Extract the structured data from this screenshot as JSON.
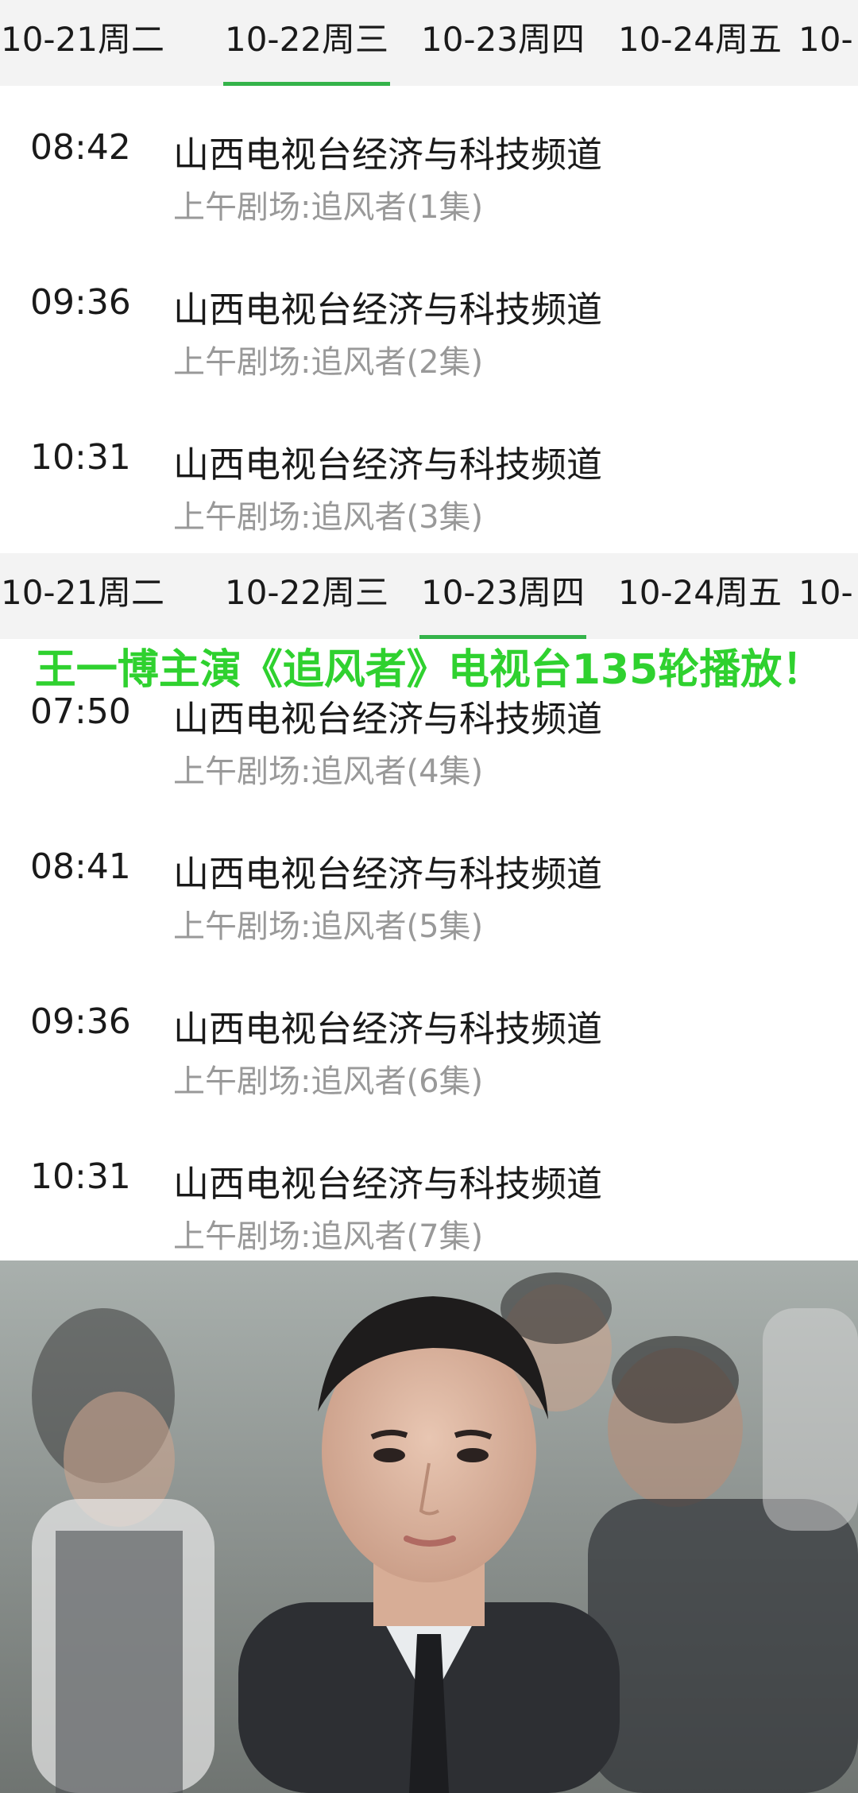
{
  "top_tabs": [
    {
      "label": "10-21周二",
      "active": false
    },
    {
      "label": "10-22周三",
      "active": true
    },
    {
      "label": "10-23周四",
      "active": false
    },
    {
      "label": "10-24周五",
      "active": false
    },
    {
      "label": "10-",
      "active": false
    }
  ],
  "top_schedule": [
    {
      "time": "08:42",
      "channel": "山西电视台经济与科技频道",
      "program": "上午剧场:追风者(1集)"
    },
    {
      "time": "09:36",
      "channel": "山西电视台经济与科技频道",
      "program": "上午剧场:追风者(2集)"
    },
    {
      "time": "10:31",
      "channel": "山西电视台经济与科技频道",
      "program": "上午剧场:追风者(3集)"
    }
  ],
  "mid_tabs": [
    {
      "label": "10-21周二",
      "active": false
    },
    {
      "label": "10-22周三",
      "active": false
    },
    {
      "label": "10-23周四",
      "active": true
    },
    {
      "label": "10-24周五",
      "active": false
    },
    {
      "label": "10-",
      "active": false
    }
  ],
  "overlay": {
    "title": "王一博主演《追风者》电视台135轮播放！",
    "color": "#2fd12f"
  },
  "mid_schedule": [
    {
      "time": "07:50",
      "channel": "山西电视台经济与科技频道",
      "program": "上午剧场:追风者(4集)"
    },
    {
      "time": "08:41",
      "channel": "山西电视台经济与科技频道",
      "program": "上午剧场:追风者(5集)"
    },
    {
      "time": "09:36",
      "channel": "山西电视台经济与科技频道",
      "program": "上午剧场:追风者(6集)"
    },
    {
      "time": "10:31",
      "channel": "山西电视台经济与科技频道",
      "program": "上午剧场:追风者(7集)"
    }
  ],
  "colors": {
    "accent": "#34b34a",
    "tab_bg": "#f3f3f3",
    "secondary_text": "#999999"
  }
}
